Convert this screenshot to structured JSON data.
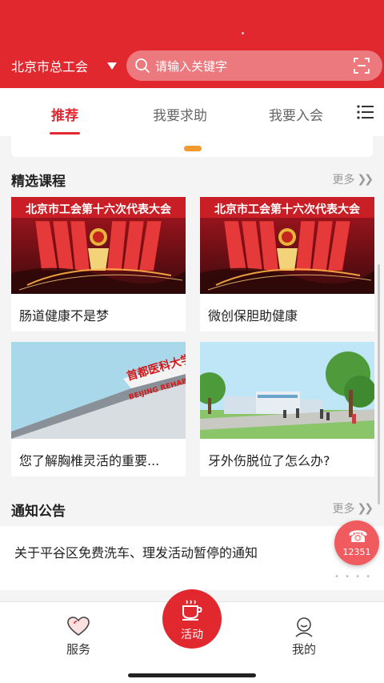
{
  "header": {
    "city": "北京市总工会",
    "search_placeholder": "请输入关键字"
  },
  "tabs": [
    {
      "label": "推荐",
      "active": true
    },
    {
      "label": "我要求助",
      "active": false
    },
    {
      "label": "我要入会",
      "active": false
    }
  ],
  "courses": {
    "title": "精选课程",
    "more": "更多",
    "items": [
      {
        "caption": "肠道健康不是梦"
      },
      {
        "caption": "微创保胆助健康"
      },
      {
        "caption": "您了解胸椎灵活的重要..."
      },
      {
        "caption": "牙外伤脱位了怎么办?"
      }
    ],
    "thumb_text": {
      "meeting": "北京市工会第十六次代表大会",
      "university": "首都医科大学",
      "university_en": "BEIJING REHAB"
    }
  },
  "notices": {
    "title": "通知公告",
    "more": "更多",
    "items": [
      {
        "text": "关于平谷区免费洗车、理发活动暂停的通知"
      }
    ]
  },
  "hotline": "12351",
  "bottom_nav": {
    "service": "服务",
    "activity": "活动",
    "mine": "我的"
  },
  "colors": {
    "brand_red": "#e1282f",
    "indicator_orange": "#f39a2e"
  }
}
